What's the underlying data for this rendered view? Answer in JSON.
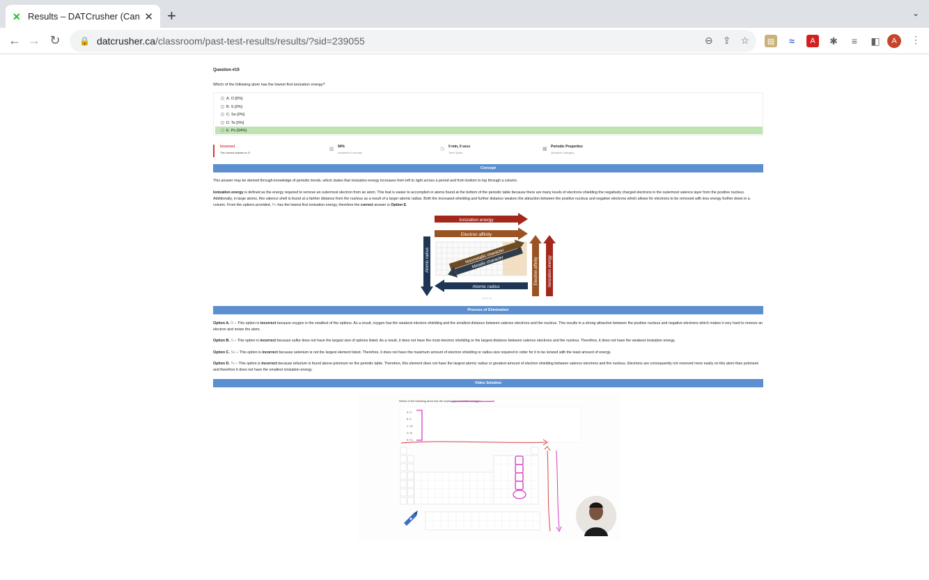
{
  "browser": {
    "tab_title": "Results – DATCrusher (Canada",
    "url_host": "datcrusher.ca",
    "url_path": "/classroom/past-test-results/results/?sid=239055",
    "avatar_letter": "A"
  },
  "question": {
    "number": "Question #19",
    "text": "Which of the following atom has the lowest first ionization energy?",
    "options": [
      "A. O [6%]",
      "B. S [0%]",
      "C. Se [0%]",
      "D. Te [0%]",
      "E. Po [94%]"
    ]
  },
  "stats": {
    "result": "Incorrect",
    "result_sub": "The correct answer is: E.",
    "percent": "94%",
    "percent_sub": "Answered Correctly",
    "time": "0 min, 0 secs",
    "time_sub": "Time Spent",
    "category": "Periodic Properties",
    "category_sub": "Question Category"
  },
  "sections": {
    "concept": "Concept",
    "elimination": "Process of Elimination",
    "video": "Video Solution"
  },
  "concept": {
    "p1": "This answer may be derived through knowledge of periodic trends, which states that ionization energy increases from left to right across a period and from bottom to top through a column.",
    "p2_term": "Ionization energy",
    "p2_a": " is defined as the energy required to remove an outermost electron from an atom. This feat is easier to accomplish in atoms found at the bottom of the periodic table because there are many levels of electrons shielding the negatively charged electrons in the outermost valence layer from the positive nucleus. Additionally, in large atoms, this valence shell is found at a farther distance from the nucleus as a result of a larger atomic radius. Both the increased shielding and further distance weaken the attraction between the positive nucleus and negative electrons which allows for electrons to be removed with less energy further down in a column. From the options provided, ",
    "p2_po": "Po",
    "p2_b": " has the lowest first ionization energy, therefore the ",
    "p2_correct": "correct",
    "p2_c": " answer is ",
    "p2_option": "Option E",
    "p2_end": ".",
    "credit": "CC BY 4.0"
  },
  "figure": {
    "ionization_energy": "Ionization energy",
    "electron_affinity": "Electron affinity",
    "nonmetallic": "Nonmetallic character",
    "metallic": "Metallic character",
    "atomic_radius": "Atomic radius",
    "atomic_radius_v": "Atomic radius",
    "electron_affinity_v": "Electron affinity",
    "ionization_energy_v": "Ionization energy"
  },
  "elimination": [
    {
      "label": "Option A.",
      "sym": "O",
      "pre": " – This option is ",
      "bold": "incorrect",
      "post": " because oxygen is the smallest of the options. As a result, oxygen has the weakest electron shielding and the smallest distance between valence electrons and the nucleus. This results in a strong attraction between the positive nucleus and negative electrons which makes it very hard to remove an electron and ionize the atom."
    },
    {
      "label": "Option B.",
      "sym": "S",
      "pre": " – This option is ",
      "bold": "incorrect",
      "post": " because sulfur does not have the largest size of options listed. As a result, it does not have the most electron shielding or the largest distance between valence electrons and the nucleus. Therefore, it does not have the weakest ionization energy."
    },
    {
      "label": "Option C.",
      "sym": "Se",
      "pre": " – This option is ",
      "bold": "incorrect",
      "post": " because selenium is not the largest element listed. Therefore, it does not have the maximum amount of electron shielding or radius size required in order for it to be ionized with the least amount of energy."
    },
    {
      "label": "Option D.",
      "sym": "Te",
      "pre": " – This option is ",
      "bold": "incorrect",
      "post": " because tellurium is found above polonium on the periodic table. Therefore, this element does not have the largest atomic radius or greatest amount of electron shielding between valence electrons and the nucleus. Electrons are consequently not removed more easily on this atom than polonium and therefore it does not have the smallest ionization energy."
    }
  ],
  "video": {
    "question": "Which of the following atom has the lowest first ionization energy?",
    "options": [
      "A. O",
      "B. S",
      "C. Se",
      "D. Te",
      "E. Po"
    ]
  },
  "colors": {
    "correct_bg": "#bfe3b1",
    "section_bar": "#5b8fd0",
    "incorrect": "#dd3333",
    "ionization_red": "#a3281c",
    "affinity_brown": "#9a5424",
    "radius_navy": "#1e3556",
    "annotation_magenta": "#d43bc2"
  }
}
